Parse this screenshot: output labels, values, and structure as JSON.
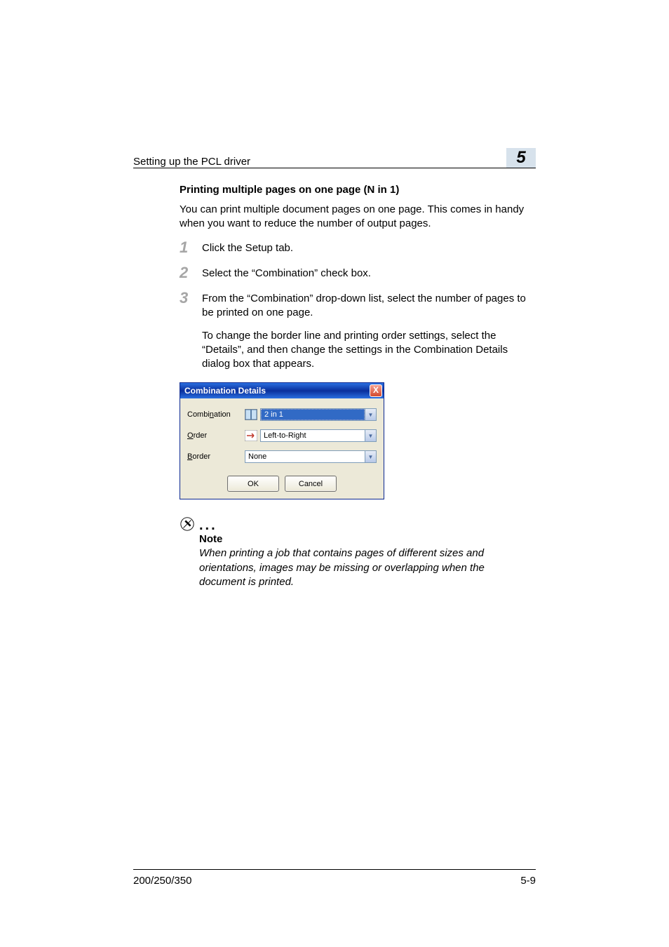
{
  "header": {
    "running_title": "Setting up the PCL driver",
    "chapter_number": "5"
  },
  "section": {
    "heading": "Printing multiple pages on one page (N in 1)",
    "intro": "You can print multiple document pages on one page. This comes in handy when you want to reduce the number of output pages."
  },
  "steps": [
    {
      "num": "1",
      "text": "Click the Setup tab."
    },
    {
      "num": "2",
      "text": "Select the “Combination” check box."
    },
    {
      "num": "3",
      "text": "From the “Combination” drop-down list, select the number of pages to be printed on one page.",
      "sub": "To change the border line and printing order settings, select the “Details”, and then change the settings in the Combination Details dialog box that appears."
    }
  ],
  "dialog": {
    "title": "Combination Details",
    "close_x": "X",
    "rows": {
      "combination": {
        "label_pre": "Combi",
        "label_u": "n",
        "label_post": "ation",
        "value": "2 in 1"
      },
      "order": {
        "label_u": "O",
        "label_post": "rder",
        "value": "Left-to-Right"
      },
      "border": {
        "label_u": "B",
        "label_post": "order",
        "value": "None"
      }
    },
    "buttons": {
      "ok": "OK",
      "cancel": "Cancel"
    }
  },
  "note": {
    "label": "Note",
    "text": "When printing a job that contains pages of different sizes and orientations, images may be missing or overlapping when the document is printed."
  },
  "footer": {
    "left": "200/250/350",
    "right": "5-9"
  }
}
